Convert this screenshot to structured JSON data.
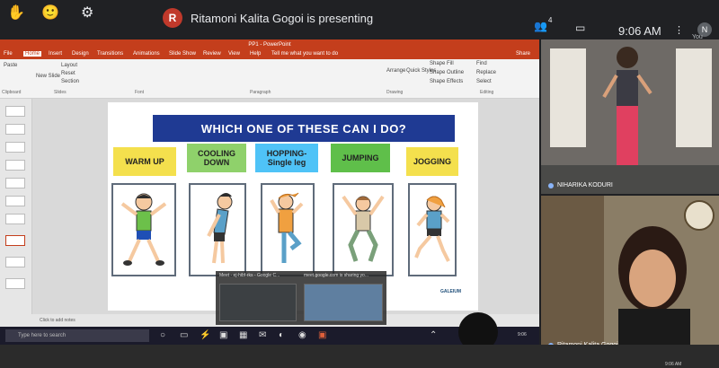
{
  "meet": {
    "presenter_initial": "R",
    "presenting_text": "Ritamoni Kalita Gogoi is presenting",
    "people_count": "4",
    "time": "9:06 AM",
    "you_label": "You",
    "self_initial": "N"
  },
  "ppt": {
    "window_title": "PP1 - PowerPoint",
    "tabs": [
      "File",
      "Home",
      "Insert",
      "Design",
      "Transitions",
      "Animations",
      "Slide Show",
      "Review",
      "View",
      "Help"
    ],
    "tell_me": "Tell me what you want to do",
    "share": "Share",
    "ribbon_groups": [
      "Clipboard",
      "Slides",
      "Font",
      "Paragraph",
      "Drawing",
      "Editing"
    ],
    "ribbon_buttons": [
      "Paste",
      "New Slide",
      "Layout",
      "Reset",
      "Section",
      "Arrange",
      "Quick Styles",
      "Shape Fill",
      "Shape Outline",
      "Shape Effects",
      "Find",
      "Replace",
      "Select"
    ],
    "notes_hint": "Click to add notes"
  },
  "slide": {
    "heading": "WHICH ONE OF THESE CAN I DO?",
    "activities": [
      {
        "label": "WARM UP",
        "color": "#f4e04d"
      },
      {
        "label": "COOLING DOWN",
        "color": "#8fd16b"
      },
      {
        "label": "HOPPING-\nSingle leg",
        "color": "#4fc3f7"
      },
      {
        "label": "JUMPING",
        "color": "#5fbf4a"
      },
      {
        "label": "JOGGING",
        "color": "#f4e04d"
      }
    ],
    "brand": "GALEIUM"
  },
  "overlay": {
    "tab1": "Meet - ej-hibf-rks - Google C...",
    "tab2": "meet.google.com is sharing yo..."
  },
  "taskbar": {
    "search_placeholder": "Type here to search",
    "clock": "9:06"
  },
  "participants": [
    {
      "name": "NIHARIKA KODURI"
    },
    {
      "name": "Ritamoni Kalita Gogoi"
    }
  ],
  "bottom_clock": "9:06 AM"
}
